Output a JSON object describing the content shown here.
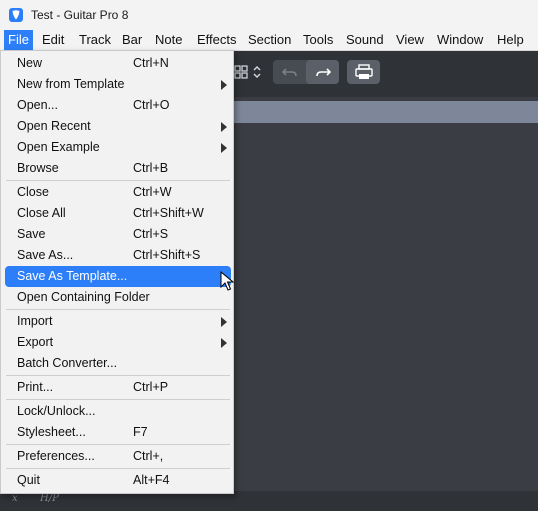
{
  "window": {
    "title": "Test - Guitar Pro 8",
    "icon": "guitar-pick-icon"
  },
  "menubar": [
    {
      "label": "File"
    },
    {
      "label": "Edit"
    },
    {
      "label": "Track"
    },
    {
      "label": "Bar"
    },
    {
      "label": "Note"
    },
    {
      "label": "Effects"
    },
    {
      "label": "Section"
    },
    {
      "label": "Tools"
    },
    {
      "label": "Sound"
    },
    {
      "label": "View"
    },
    {
      "label": "Window"
    },
    {
      "label": "Help"
    }
  ],
  "file_menu": {
    "items": [
      {
        "label": "New",
        "shortcut": "Ctrl+N"
      },
      {
        "label": "New from Template",
        "shortcut": "",
        "submenu": true
      },
      {
        "label": "Open...",
        "shortcut": "Ctrl+O"
      },
      {
        "label": "Open Recent",
        "shortcut": "",
        "submenu": true
      },
      {
        "label": "Open Example",
        "shortcut": "",
        "submenu": true
      },
      {
        "label": "Browse",
        "shortcut": "Ctrl+B"
      },
      {
        "label": "Close",
        "shortcut": "Ctrl+W"
      },
      {
        "label": "Close All",
        "shortcut": "Ctrl+Shift+W"
      },
      {
        "label": "Save",
        "shortcut": "Ctrl+S"
      },
      {
        "label": "Save As...",
        "shortcut": "Ctrl+Shift+S"
      },
      {
        "label": "Save As Template...",
        "shortcut": "",
        "highlighted": true
      },
      {
        "label": "Open Containing Folder",
        "shortcut": ""
      },
      {
        "label": "Import",
        "shortcut": "",
        "submenu": true
      },
      {
        "label": "Export",
        "shortcut": "",
        "submenu": true
      },
      {
        "label": "Batch Converter...",
        "shortcut": ""
      },
      {
        "label": "Print...",
        "shortcut": "Ctrl+P"
      },
      {
        "label": "Lock/Unlock...",
        "shortcut": ""
      },
      {
        "label": "Stylesheet...",
        "shortcut": "F7"
      },
      {
        "label": "Preferences...",
        "shortcut": "Ctrl+,"
      },
      {
        "label": "Quit",
        "shortcut": "Alt+F4"
      }
    ]
  },
  "toolbar": {
    "icons": [
      "layout-grid-icon",
      "undo-icon",
      "redo-icon",
      "print-icon"
    ]
  },
  "bottom_strip": {
    "glyphs": [
      "x",
      "H/P"
    ]
  },
  "colors": {
    "accent": "#2d7ff9",
    "menu_bg": "#f2f2f2",
    "app_bg": "#3a3d43",
    "strip": "#7e8799"
  }
}
